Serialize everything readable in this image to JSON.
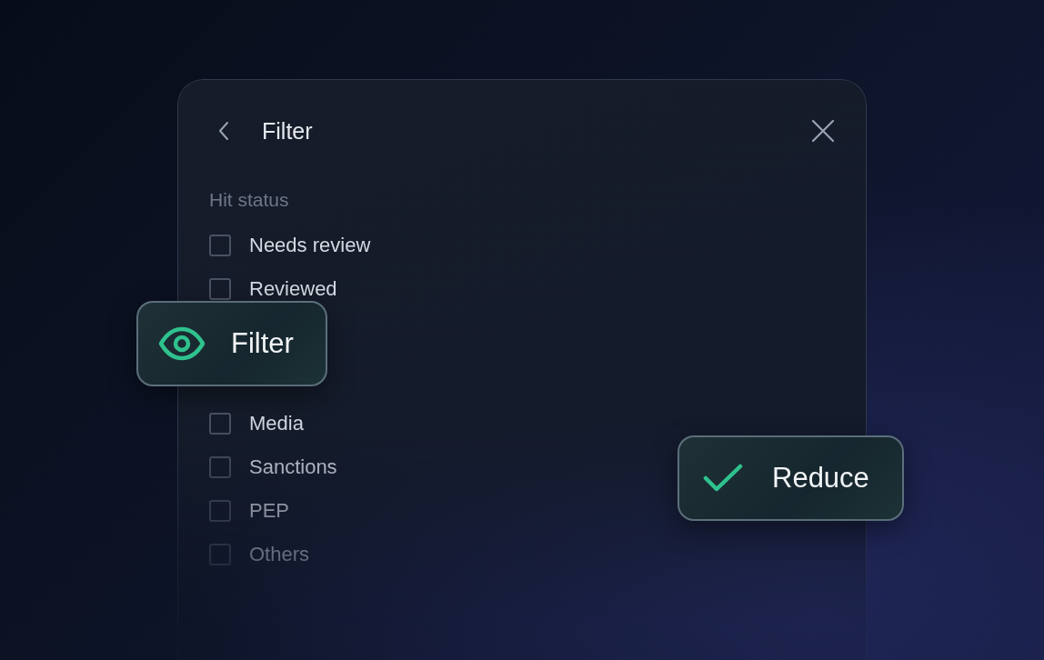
{
  "panel": {
    "title": "Filter",
    "sections": [
      {
        "title": "Hit status",
        "options": [
          {
            "label": "Needs review",
            "checked": false
          },
          {
            "label": "Reviewed",
            "checked": false
          }
        ]
      },
      {
        "options": [
          {
            "label": "Media",
            "checked": false
          },
          {
            "label": "Sanctions",
            "checked": false
          },
          {
            "label": "PEP",
            "checked": false
          },
          {
            "label": "Others",
            "checked": false
          }
        ]
      }
    ]
  },
  "chips": [
    {
      "kind": "eye",
      "label": "Filter"
    },
    {
      "kind": "check",
      "label": "Reduce"
    }
  ]
}
